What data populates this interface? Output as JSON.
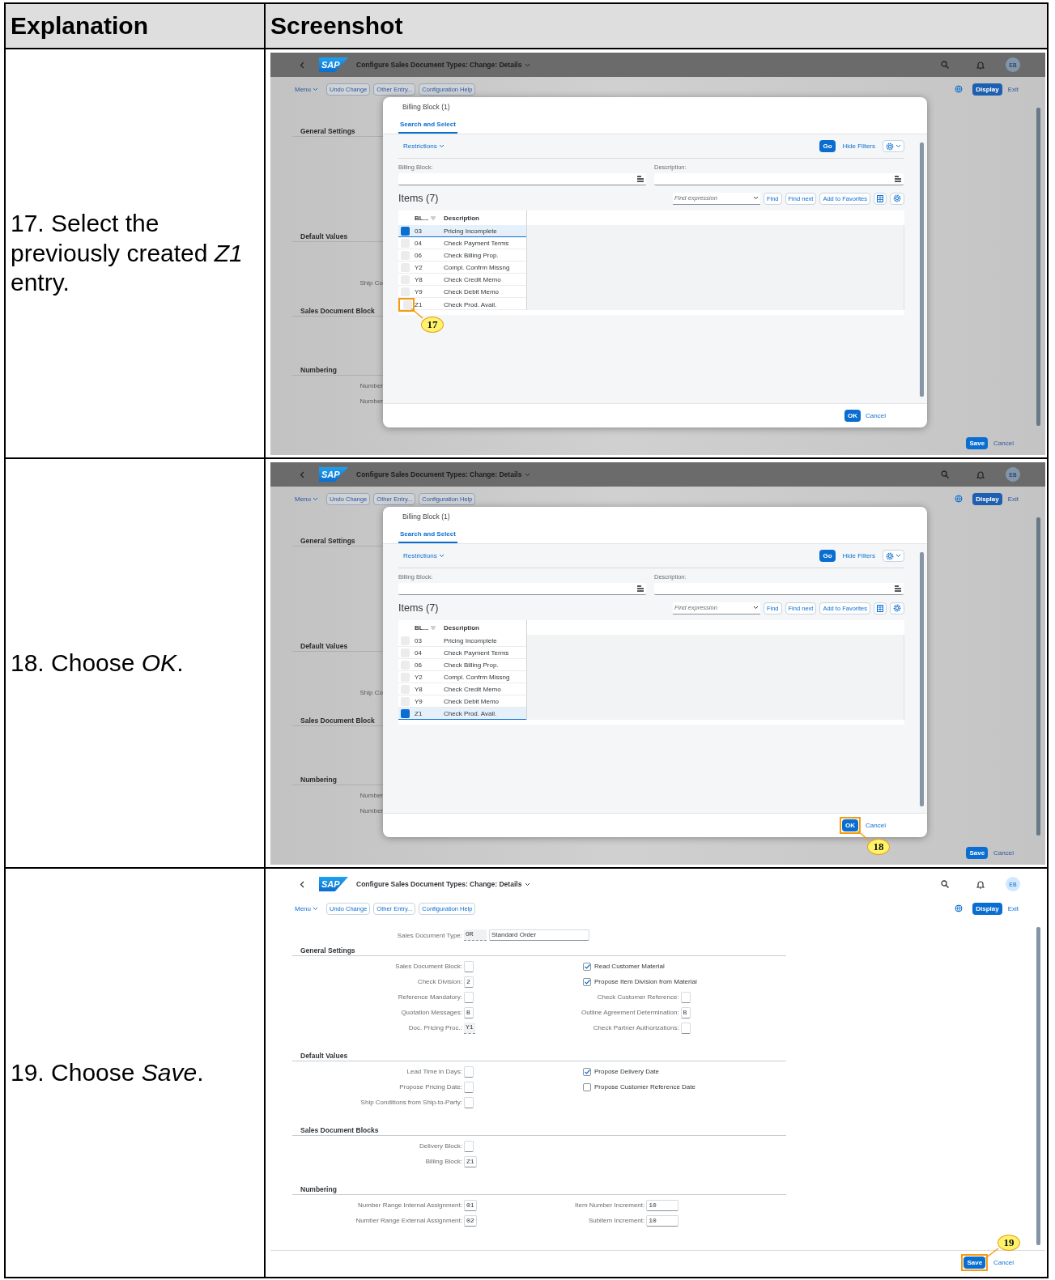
{
  "table": {
    "columns": [
      "Explanation",
      "Screenshot"
    ]
  },
  "steps": [
    {
      "explanation": "17. Select the previously created *Z1* entry.",
      "screen": {
        "kind": "dialog",
        "shell": {
          "logo": "SAP",
          "title": "Configure Sales Document Types: Change: Details",
          "avatar": "EB"
        },
        "toolbar": {
          "menu": "Menu",
          "buttons": [
            "Undo Change",
            "Other Entry...",
            "Configuration Help"
          ],
          "primary": "Display",
          "exit": "Exit"
        },
        "background": {
          "sections": [
            {
              "title": "General Settings"
            },
            {
              "title": "Default Values",
              "labels": [
                "Ship Co"
              ]
            },
            {
              "title": "Sales Document Block"
            },
            {
              "title": "Numbering",
              "labels": [
                "Number",
                "Number"
              ]
            }
          ]
        },
        "dialog": {
          "title": "Billing Block (1)",
          "tabs": [
            {
              "label": "Search and Select",
              "selected": true
            }
          ],
          "restrictions": "Restrictions",
          "go": "Go",
          "hide_filters": "Hide Filters",
          "filters": [
            {
              "label": "Billing Block:"
            },
            {
              "label": "Description:"
            }
          ],
          "items_title": "Items (7)",
          "find": {
            "placeholder": "Find expression"
          },
          "find_buttons": [
            "Find",
            "Find next",
            "Add to Favorites"
          ],
          "columns": [
            "BL...",
            "Description"
          ],
          "rows": [
            {
              "code": "03",
              "description": "Pricing Incomplete",
              "selected": true
            },
            {
              "code": "04",
              "description": "Check Payment Terms",
              "selected": false
            },
            {
              "code": "06",
              "description": "Check Billing Prop.",
              "selected": false
            },
            {
              "code": "Y2",
              "description": "Compl. Confrm Missng",
              "selected": false
            },
            {
              "code": "Y8",
              "description": "Check Credit Memo",
              "selected": false
            },
            {
              "code": "Y9",
              "description": "Check Debit Memo",
              "selected": false
            },
            {
              "code": "Z1",
              "description": "Check Prod. Avail.",
              "selected": false,
              "callout": {
                "label": "17"
              }
            }
          ],
          "ok": {
            "label": "OK"
          },
          "cancel": "Cancel"
        },
        "footer": {
          "save": {
            "label": "Save"
          },
          "cancel": "Cancel"
        }
      }
    },
    {
      "explanation": "18. Choose *OK*.",
      "screen": {
        "kind": "dialog",
        "shell": {
          "logo": "SAP",
          "title": "Configure Sales Document Types: Change: Details",
          "avatar": "EB"
        },
        "toolbar": {
          "menu": "Menu",
          "buttons": [
            "Undo Change",
            "Other Entry...",
            "Configuration Help"
          ],
          "primary": "Display",
          "exit": "Exit"
        },
        "background": {
          "sections": [
            {
              "title": "General Settings"
            },
            {
              "title": "Default Values",
              "labels": [
                "Ship Co"
              ]
            },
            {
              "title": "Sales Document Block"
            },
            {
              "title": "Numbering",
              "labels": [
                "Number",
                "Number"
              ]
            }
          ]
        },
        "dialog": {
          "title": "Billing Block (1)",
          "tabs": [
            {
              "label": "Search and Select",
              "selected": true
            }
          ],
          "restrictions": "Restrictions",
          "go": "Go",
          "hide_filters": "Hide Filters",
          "filters": [
            {
              "label": "Billing Block:"
            },
            {
              "label": "Description:"
            }
          ],
          "items_title": "Items (7)",
          "find": {
            "placeholder": "Find expression"
          },
          "find_buttons": [
            "Find",
            "Find next",
            "Add to Favorites"
          ],
          "columns": [
            "BL...",
            "Description"
          ],
          "rows": [
            {
              "code": "03",
              "description": "Pricing Incomplete",
              "selected": false
            },
            {
              "code": "04",
              "description": "Check Payment Terms",
              "selected": false
            },
            {
              "code": "06",
              "description": "Check Billing Prop.",
              "selected": false
            },
            {
              "code": "Y2",
              "description": "Compl. Confrm Missng",
              "selected": false
            },
            {
              "code": "Y8",
              "description": "Check Credit Memo",
              "selected": false
            },
            {
              "code": "Y9",
              "description": "Check Debit Memo",
              "selected": false
            },
            {
              "code": "Z1",
              "description": "Check Prod. Avail.",
              "selected": true
            }
          ],
          "ok": {
            "label": "OK",
            "callout": {
              "label": "18"
            }
          },
          "cancel": "Cancel"
        },
        "footer": {
          "save": {
            "label": "Save"
          },
          "cancel": "Cancel"
        }
      }
    },
    {
      "explanation": "19. Choose *Save*.",
      "screen": {
        "kind": "form",
        "shell": {
          "logo": "SAP",
          "title": "Configure Sales Document Types: Change: Details",
          "avatar": "EB"
        },
        "toolbar": {
          "menu": "Menu",
          "buttons": [
            "Undo Change",
            "Other Entry...",
            "Configuration Help"
          ],
          "primary": "Display",
          "exit": "Exit"
        },
        "header_field": {
          "label": "Sales Document Type:",
          "code": "OR",
          "text": "Standard Order"
        },
        "sections": [
          {
            "title": "General Settings",
            "left": [
              {
                "kind": "input",
                "label": "Sales Document Block:"
              },
              {
                "kind": "input",
                "label": "Check Division:",
                "value": "2"
              },
              {
                "kind": "input",
                "label": "Reference Mandatory:"
              },
              {
                "kind": "input",
                "label": "Quotation Messages:",
                "value": "B"
              },
              {
                "kind": "readonly",
                "label": "Doc. Pricing Proc.:",
                "value": "Y1"
              }
            ],
            "right": [
              {
                "kind": "checkbox",
                "label": "Read Customer Material",
                "checked": true
              },
              {
                "kind": "checkbox",
                "label": "Propose Item Division from Material",
                "checked": true
              },
              {
                "kind": "input",
                "label": "Check Customer Reference:"
              },
              {
                "kind": "input",
                "label": "Outline Agreement Determination:",
                "value": "B"
              },
              {
                "kind": "input",
                "label": "Check Partner Authorizations:"
              }
            ]
          },
          {
            "title": "Default Values",
            "left": [
              {
                "kind": "input",
                "label": "Lead Time in Days:"
              },
              {
                "kind": "input",
                "label": "Propose Pricing Date:"
              },
              {
                "kind": "input",
                "label": "Ship Conditions from Ship-to-Party:"
              }
            ],
            "right": [
              {
                "kind": "checkbox",
                "label": "Propose Delivery Date",
                "checked": true
              },
              {
                "kind": "checkbox",
                "label": "Propose Customer Reference Date",
                "checked": false
              }
            ]
          },
          {
            "title": "Sales Document Blocks",
            "left": [
              {
                "kind": "input",
                "label": "Delivery Block:"
              },
              {
                "kind": "input",
                "label": "Billing Block:",
                "value": "Z1"
              }
            ]
          },
          {
            "title": "Numbering",
            "left": [
              {
                "kind": "input",
                "label": "Number Range Internal Assignment:",
                "value": "01"
              },
              {
                "kind": "input",
                "label": "Number Range External Assignment:",
                "value": "02"
              }
            ],
            "right": [
              {
                "kind": "wide-input",
                "label": "Item Number Increment:",
                "value": "10"
              },
              {
                "kind": "wide-input",
                "label": "Subitem Increment:",
                "value": "10"
              }
            ]
          }
        ],
        "footer": {
          "save": {
            "label": "Save",
            "callout": {
              "label": "19"
            }
          },
          "cancel": "Cancel"
        }
      }
    }
  ]
}
